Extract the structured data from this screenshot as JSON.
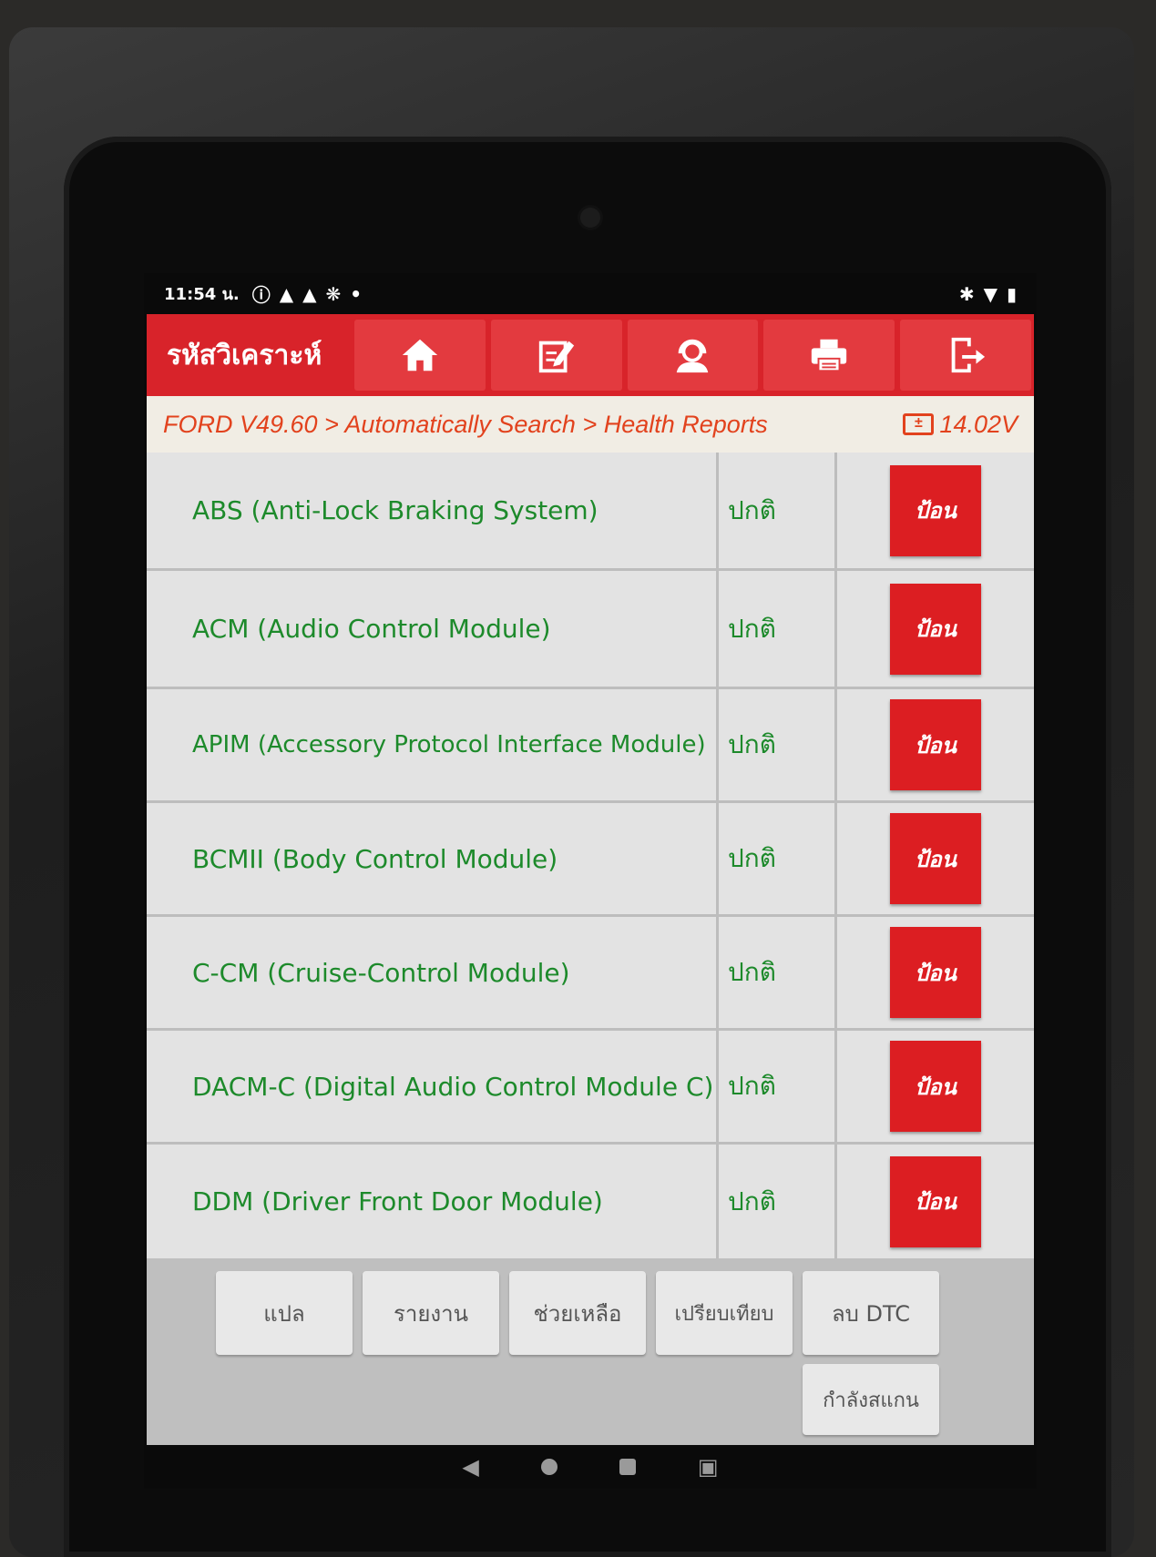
{
  "status_bar": {
    "time": "11:54 น.",
    "left_icons": [
      "alert-icon",
      "warning-icon",
      "warning-icon",
      "bluetooth-icon",
      "dot-icon"
    ],
    "right_icons": [
      "bluetooth-icon",
      "wifi-icon",
      "battery-icon"
    ]
  },
  "app_bar": {
    "title": "รหัสวิเคราะห์",
    "buttons": [
      "home-icon",
      "edit-icon",
      "support-icon",
      "print-icon",
      "exit-icon"
    ],
    "accent_color": "#d8232a"
  },
  "breadcrumb": {
    "path": "FORD V49.60 > Automatically Search > Health Reports",
    "voltage": "14.02V"
  },
  "modules": [
    {
      "name": "ABS (Anti-Lock Braking System)",
      "status": "ปกติ",
      "action": "ป้อน"
    },
    {
      "name": "ACM (Audio Control Module)",
      "status": "ปกติ",
      "action": "ป้อน"
    },
    {
      "name": "APIM (Accessory Protocol Interface Module)",
      "status": "ปกติ",
      "action": "ป้อน"
    },
    {
      "name": "BCMII (Body Control Module)",
      "status": "ปกติ",
      "action": "ป้อน"
    },
    {
      "name": "C-CM (Cruise-Control Module)",
      "status": "ปกติ",
      "action": "ป้อน"
    },
    {
      "name": "DACM-C (Digital Audio Control Module C)",
      "status": "ปกติ",
      "action": "ป้อน"
    },
    {
      "name": "DDM (Driver Front Door Module)",
      "status": "ปกติ",
      "action": "ป้อน"
    }
  ],
  "bottom_buttons": {
    "translate": "แปล",
    "report": "รายงาน",
    "help": "ช่วยเหลือ",
    "compare": "เปรียบเทียบ",
    "clear_dtc": "ลบ DTC",
    "scanning": "กำลังสแกน"
  }
}
